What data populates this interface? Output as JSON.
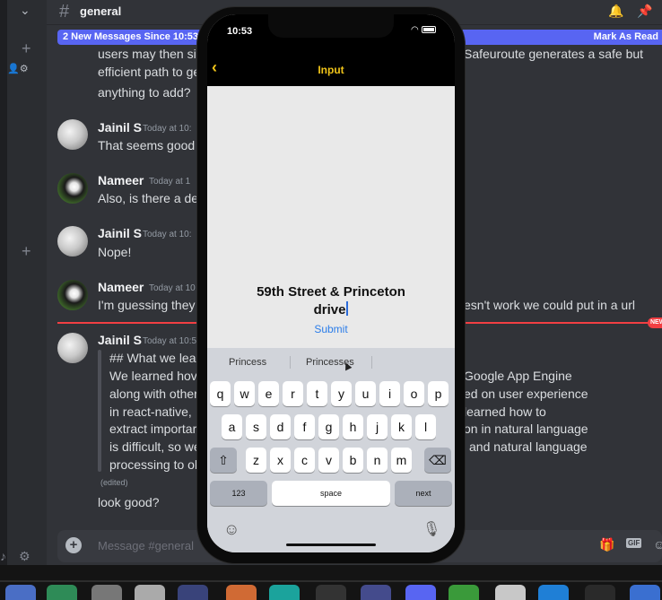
{
  "discord": {
    "channel_name": "general",
    "new_messages_banner": "2 New Messages Since 10:53 P",
    "mark_as_read": "Mark As Read",
    "composer_placeholder": "Message #general",
    "gif_label": "GIF",
    "new_badge": "NEW",
    "partial_lines": {
      "line1": "users may then sir",
      "line2": "efficient path to ge",
      "line3": "anything to add?",
      "right1": "Safeuroute generates a safe but"
    },
    "messages": [
      {
        "author": "Jainil S",
        "time": "Today at 10:",
        "text": "That seems good"
      },
      {
        "author": "Nameer",
        "time": "Today at 1",
        "text": "Also, is there a de"
      },
      {
        "author": "Jainil S",
        "time": "Today at 10:",
        "text": "Nope!"
      },
      {
        "author": "Nameer",
        "time": "Today at 10",
        "text": "I'm guessing they",
        "right": "esn't work we could put in a url"
      },
      {
        "author": "Jainil S",
        "time": "Today at 10:5"
      }
    ],
    "quote_lines_left": [
      "## What we lea",
      "We learned hov",
      "along with other",
      "in react-native,",
      "extract importar",
      "is difficult, so we",
      "processing to ol"
    ],
    "quote_lines_right": [
      "Google App Engine",
      "ed on user experience",
      "learned how to",
      "on in natural language",
      "and natural language"
    ],
    "edited": "(edited)",
    "last_message": "look good?"
  },
  "phone": {
    "time": "10:53",
    "nav_title": "Input",
    "address": "59th Street & Princeton\ndrive",
    "submit": "Submit",
    "suggestions": [
      "Princess",
      "Princesses"
    ],
    "keys_row1": [
      "q",
      "w",
      "e",
      "r",
      "t",
      "y",
      "u",
      "i",
      "o",
      "p"
    ],
    "keys_row2": [
      "a",
      "s",
      "d",
      "f",
      "g",
      "h",
      "j",
      "k",
      "l"
    ],
    "keys_row3": [
      "z",
      "x",
      "c",
      "v",
      "b",
      "n",
      "m"
    ],
    "key_123": "123",
    "key_space": "space",
    "key_next": "next"
  },
  "colors": {
    "discord_bg": "#313338",
    "blurple": "#5865f2",
    "accent_yellow": "#f0c419",
    "link_blue": "#2b7de9"
  }
}
